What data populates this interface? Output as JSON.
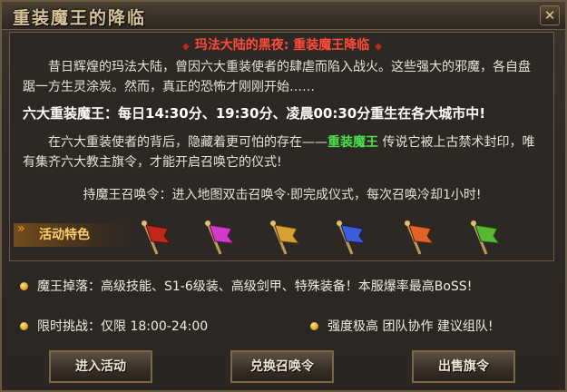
{
  "window": {
    "title": "重装魔王的降临",
    "close_label": "✕"
  },
  "banner": {
    "left": "◆",
    "text": "玛法大陆的黑夜: 重装魔王降临",
    "right": "◆"
  },
  "story": {
    "p1": "昔日辉煌的玛法大陆，曾因六大重装使者的肆虐而陷入战火。这些强大的邪魔，各自盘踞一方生灵涂炭。然而，真正的恐怖才刚刚开始……",
    "p2": "六大重装魔王：每日14:30分、19:30分、凌晨00:30分重生在各大城市中!",
    "p3_pre": "在六大重装使者的背后，隐藏着更可怕的存在——",
    "p3_highlight": "重装魔王",
    "p3_post": " 传说它被上古禁术封印，唯有集齐六大教主旗令，才能开启召唤它的仪式!",
    "p4": "持魔王召唤令：进入地图双击召唤令·即完成仪式，每次召唤冷却1小时!"
  },
  "features": {
    "label": "活动特色",
    "arrow": "»",
    "flags": [
      {
        "name": "red-flag-icon",
        "color": "#c0281c"
      },
      {
        "name": "magenta-flag-icon",
        "color": "#d43ac8"
      },
      {
        "name": "gold-flag-icon",
        "color": "#d8a030"
      },
      {
        "name": "blue-flag-icon",
        "color": "#3c5cd8"
      },
      {
        "name": "orange-flag-icon",
        "color": "#e0642a"
      },
      {
        "name": "green-flag-icon",
        "color": "#58b834"
      }
    ]
  },
  "info": {
    "drops": "魔王掉落：高级技能、S1-6级装、高级剑甲、特殊装备！本服爆率最高BoSS!",
    "time": "限时挑战：仅限 18:00-24:00",
    "difficulty": "强度极高 团队协作 建议组队!"
  },
  "buttons": {
    "enter": "进入活动",
    "exchange": "兑换召唤令",
    "sell": "出售旗令"
  }
}
